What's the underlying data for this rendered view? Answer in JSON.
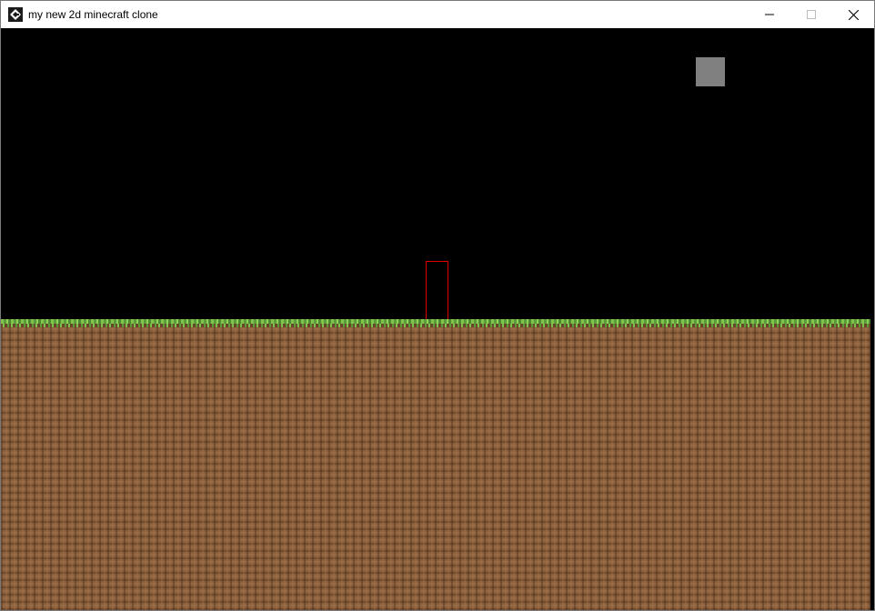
{
  "window": {
    "title": "my new 2d minecraft clone",
    "icons": {
      "app": "game-app-icon",
      "minimize": "minimize-icon",
      "maximize": "maximize-icon",
      "close": "close-icon"
    }
  },
  "game": {
    "colors": {
      "sky": "#000000",
      "grass": "#5e9b3c",
      "dirt": "#8a5f3c",
      "player_outline": "#e00000",
      "hud_square": "#808080"
    }
  }
}
